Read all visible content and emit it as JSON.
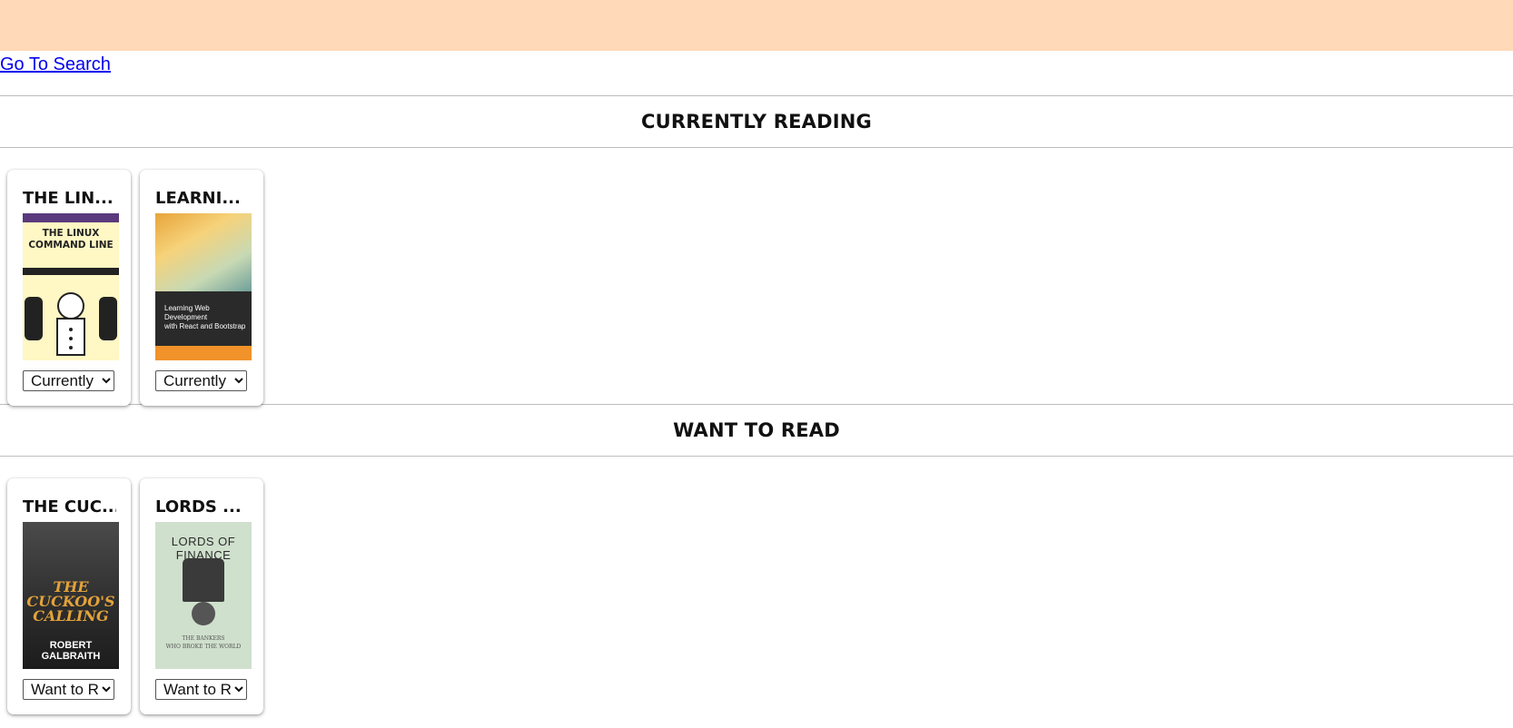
{
  "header": {
    "search_link": "Go To Search"
  },
  "shelves": [
    {
      "title": "CURRENTLY READING",
      "books": [
        {
          "title": "THE LIN...",
          "shelf_value": "Currently"
        },
        {
          "title": "LEARNI...",
          "shelf_value": "Currently"
        }
      ]
    },
    {
      "title": "WANT TO READ",
      "books": [
        {
          "title": "THE CUC...",
          "shelf_value": "Want to R"
        },
        {
          "title": "LORDS ...",
          "shelf_value": "Want to R"
        }
      ]
    }
  ],
  "covers": {
    "linux": {
      "line1": "THE LINUX",
      "line2": "COMMAND LINE"
    },
    "webdev": {
      "line1": "Learning Web Development",
      "line2": "with React and Bootstrap"
    },
    "cuckoo": {
      "line1": "THE",
      "line2": "CUCKOO'S",
      "line3": "CALLING",
      "author": "ROBERT GALBRAITH"
    },
    "lords": {
      "title": "LORDS OF FINANCE",
      "sub1": "THE BANKERS",
      "sub2": "WHO BROKE THE WORLD"
    }
  },
  "colors": {
    "header_bg": "#ffd9b8",
    "link": "#0000ee",
    "divider": "#bdbdbd"
  }
}
